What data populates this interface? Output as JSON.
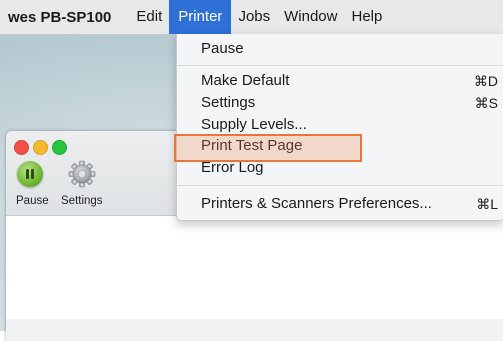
{
  "menubar": {
    "app_name": "wes PB-SP100",
    "items": [
      "Edit",
      "Printer",
      "Jobs",
      "Window",
      "Help"
    ],
    "active_item": "Printer",
    "active_color": "#2f6fd8"
  },
  "printer_menu": {
    "items": {
      "pause": "Pause",
      "make_default": "Make Default",
      "make_default_shortcut": "⌘D",
      "settings": "Settings",
      "settings_shortcut": "⌘S",
      "supply_levels": "Supply Levels...",
      "print_test_page": "Print Test Page",
      "error_log": "Error Log",
      "preferences": "Printers & Scanners Preferences...",
      "preferences_shortcut": "⌘L"
    },
    "highlighted_item": "Print Test Page",
    "highlight_color": "#e8763a"
  },
  "printer_window": {
    "toolbar": {
      "pause_label": "Pause",
      "settings_label": "Settings"
    },
    "icons": {
      "close": "close-light",
      "minimize": "minimize-light",
      "maximize": "maximize-light",
      "pause": "pause-icon",
      "settings": "gear-icon"
    }
  }
}
